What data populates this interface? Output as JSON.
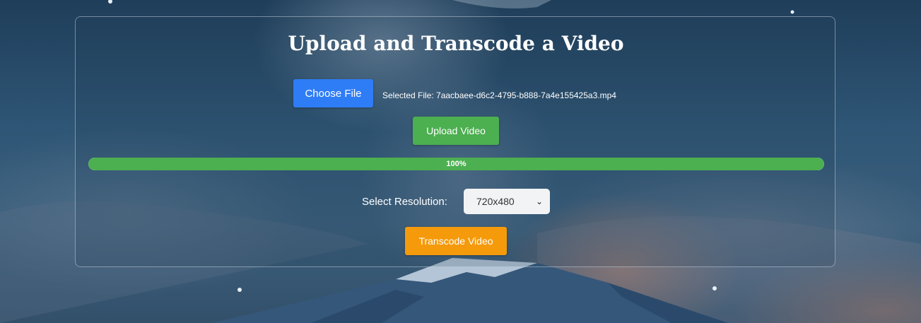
{
  "page": {
    "title": "Upload and Transcode a Video"
  },
  "file_picker": {
    "choose_label": "Choose File",
    "selected_text": "Selected File: 7aacbaee-d6c2-4795-b888-7a4e155425a3.mp4"
  },
  "upload": {
    "button_label": "Upload Video"
  },
  "progress": {
    "value_percent": 100,
    "label": "100%",
    "fill_color": "#4caf50"
  },
  "resolution": {
    "label": "Select Resolution:",
    "selected": "720x480"
  },
  "transcode": {
    "button_label": "Transcode Video"
  },
  "colors": {
    "choose_button": "#2f7df6",
    "upload_button": "#4caf50",
    "transcode_button": "#f59a0b"
  },
  "icons": {
    "select_chevron": "chevron-down-icon"
  }
}
